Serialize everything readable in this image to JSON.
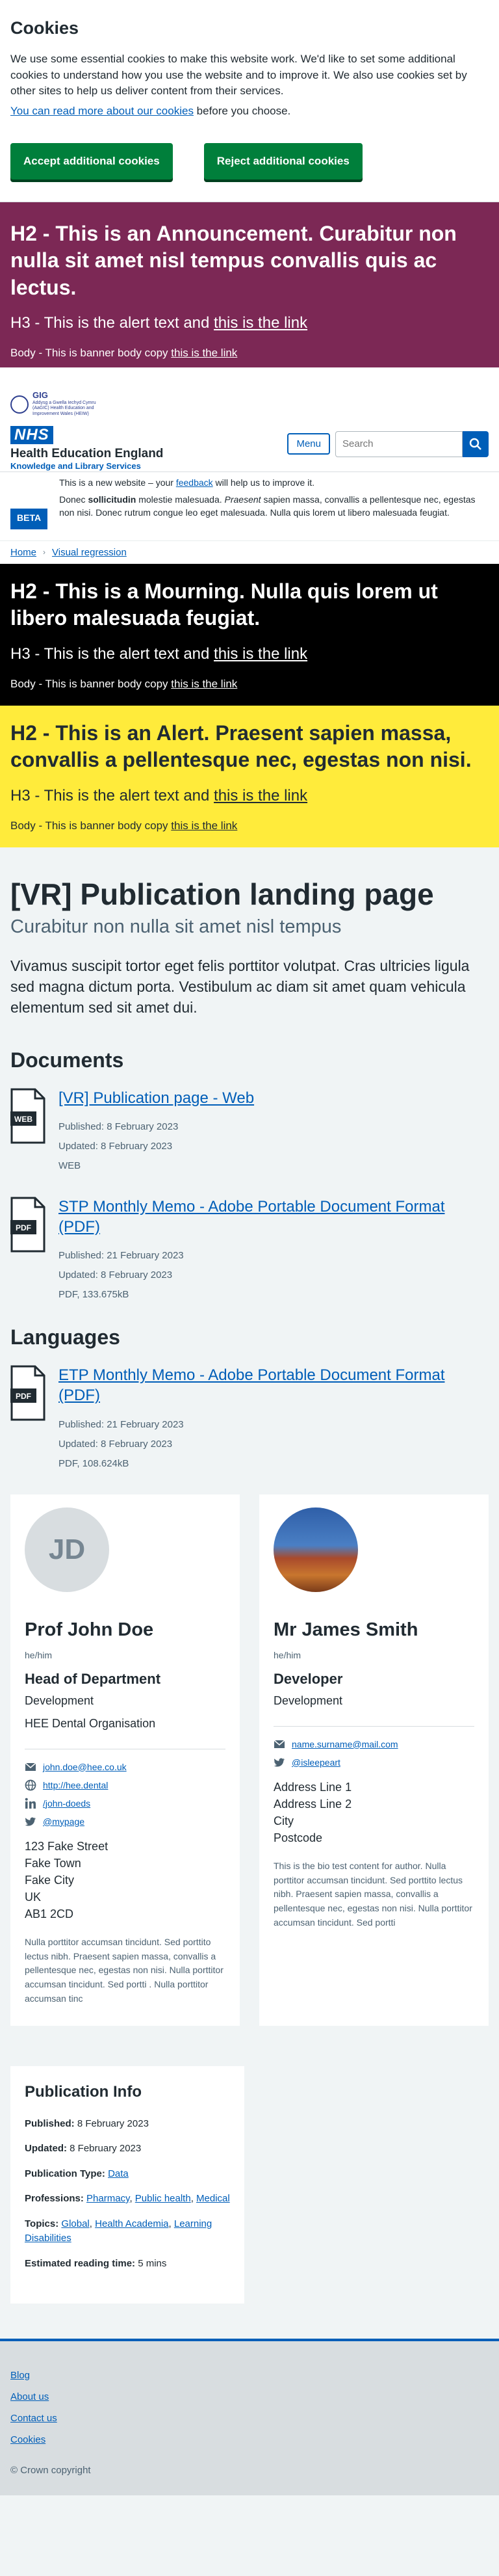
{
  "cookie": {
    "title": "Cookies",
    "text": "We use some essential cookies to make this website work. We'd like to set some additional cookies to understand how you use the website and to improve it. We also use cookies set by other sites to help us deliver content from their services.",
    "link": "You can read more about our cookies",
    "after_link": " before you choose.",
    "accept_label": "Accept additional cookies",
    "reject_label": "Reject additional cookies"
  },
  "announcement": {
    "heading": "H2 - This is an Announcement. Curabitur non nulla sit amet nisl tempus convallis quis ac lectus.",
    "h3_text": "H3 - This is the alert text and ",
    "h3_link": "this is the link",
    "body_text": "Body - This is banner body copy ",
    "body_link": "this is the link",
    "color": "#7c2855"
  },
  "header": {
    "partner_name": "GIG",
    "partner_small": "Addysg a Gwella Iechyd Cymru (AaGIC) Health Education and Improvement Wales (HEIW)",
    "nhs": "NHS",
    "org_name": "Health Education England",
    "org_sub": "Knowledge and Library Services",
    "menu_label": "Menu",
    "search_placeholder": "Search"
  },
  "phase": {
    "tag": "BETA",
    "line1_pre": "This is a new website – your ",
    "line1_link": "feedback",
    "line1_post": " will help us to improve it.",
    "line2_a": "Donec ",
    "line2_bold": "sollicitudin",
    "line2_b": " molestie malesuada. ",
    "line2_italic": "Praesent",
    "line2_c": " sapien massa, convallis a pellentesque nec, egestas non nisi. Donec rutrum congue leo eget malesuada. Nulla quis lorem ut libero malesuada feugiat."
  },
  "breadcrumb": {
    "home": "Home",
    "current": "Visual regression"
  },
  "mourning": {
    "heading": "H2 - This is a Mourning. Nulla quis lorem ut libero malesuada feugiat.",
    "h3_text": "H3 - This is the alert text and ",
    "h3_link": "this is the link",
    "body_text": "Body - This is banner body copy ",
    "body_link": "this is the link"
  },
  "alert": {
    "heading": "H2 - This is an Alert. Praesent sapien massa, convallis a pellentesque nec, egestas non nisi.",
    "h3_text": "H3 - This is the alert text and ",
    "h3_link": "this is the link",
    "body_text": "Body - This is banner body copy ",
    "body_link": "this is the link",
    "color": "#ffeb3b"
  },
  "page": {
    "title": "[VR] Publication landing page",
    "subtitle": "Curabitur non nulla sit amet nisl tempus",
    "intro": "Vivamus suscipit tortor eget felis porttitor volutpat. Cras ultricies ligula sed magna dictum porta. Vestibulum ac diam sit amet quam vehicula elementum sed sit amet dui."
  },
  "documents": {
    "heading": "Documents",
    "items": [
      {
        "title": "[VR] Publication page - Web",
        "published": "8 February 2023",
        "updated": "8 February 2023",
        "type": "WEB",
        "icon": "WEB"
      },
      {
        "title": "STP Monthly Memo - Adobe Portable Document Format (PDF)",
        "published": "21 February 2023",
        "updated": "8 February 2023",
        "type": "PDF, 133.675kB",
        "icon": "PDF"
      }
    ]
  },
  "languages": {
    "heading": "Languages",
    "items": [
      {
        "title": "ETP Monthly Memo - Adobe Portable Document Format (PDF)",
        "published": "21 February 2023",
        "updated": "8 February 2023",
        "type": "PDF, 108.624kB",
        "icon": "PDF"
      }
    ]
  },
  "labels": {
    "published": "Published: ",
    "updated": "Updated: "
  },
  "authors": [
    {
      "initials": "JD",
      "name": "Prof John Doe",
      "pronouns": "he/him",
      "role": "Head of Department",
      "department": "Development",
      "organisation": "HEE Dental Organisation",
      "email": "john.doe@hee.co.uk",
      "website": "http://hee.dental",
      "linkedin": "/john-doeds",
      "twitter": "@mypage",
      "address": [
        "123 Fake Street",
        "Fake Town",
        "Fake City",
        "UK",
        "AB1 2CD"
      ],
      "bio": "Nulla porttitor accumsan tincidunt. Sed porttito lectus nibh. Praesent sapien massa, convallis a pellentesque nec, egestas non nisi. Nulla porttitor accumsan tincidunt. Sed portti . Nulla porttitor accumsan tinc"
    },
    {
      "initials": "",
      "name": "Mr James Smith",
      "pronouns": "he/him",
      "role": "Developer",
      "department": "Development",
      "email": "name.surname@mail.com",
      "twitter": "@isleepeart",
      "address": [
        "Address Line 1",
        "Address Line 2",
        "City",
        "Postcode"
      ],
      "bio": "This is the bio test content for author. Nulla porttitor accumsan tincidunt. Sed porttito lectus nibh. Praesent sapien massa, convallis a pellentesque nec, egestas non nisi. Nulla porttitor accumsan tincidunt. Sed portti"
    }
  ],
  "pubinfo": {
    "heading": "Publication Info",
    "published_label": "Published:",
    "published": "8 February 2023",
    "updated_label": "Updated:",
    "updated": "8 February 2023",
    "type_label": "Publication Type:",
    "type": "Data",
    "professions_label": "Professions:",
    "professions": [
      "Pharmacy",
      "Public health",
      "Medical"
    ],
    "topics_label": "Topics:",
    "topics": [
      "Global",
      "Health Academia",
      "Learning Disabilities"
    ],
    "reading_label": "Estimated reading time:",
    "reading": "5 mins"
  },
  "footer": {
    "links": [
      "Blog",
      "About us",
      "Contact us",
      "Cookies"
    ],
    "copyright": "© Crown copyright"
  }
}
